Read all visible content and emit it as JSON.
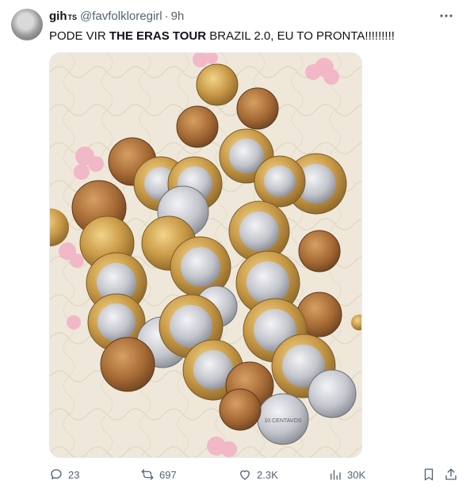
{
  "tweet": {
    "author": {
      "display_name": "gih",
      "name_badge": "TS",
      "handle": "@favfolkloregirl",
      "time": "9h"
    },
    "text_before": "PODE VIR ",
    "text_bold": "THE ERAS TOUR",
    "text_after": " BRAZIL 2.0, EU TO PRONTA!!!!!!!!!",
    "media": {
      "description": "pile of Brazilian coins on a quilted fabric",
      "coin_marking": "10 CENTAVOS"
    },
    "metrics": {
      "replies": "23",
      "reposts": "697",
      "likes": "2.3K",
      "views": "30K"
    }
  },
  "icons": {
    "more": "more-dots-icon",
    "reply": "reply-bubble-icon",
    "repost": "repost-icon",
    "like": "heart-icon",
    "views": "views-chart-icon",
    "bookmark": "bookmark-icon",
    "share": "share-icon"
  }
}
